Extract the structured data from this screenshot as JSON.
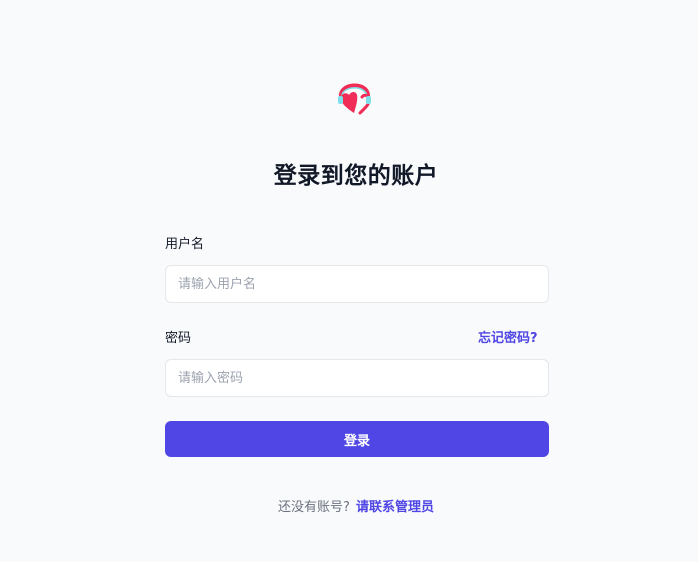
{
  "login": {
    "title": "登录到您的账户",
    "username_label": "用户名",
    "username_placeholder": "请输入用户名",
    "password_label": "密码",
    "forgot_link": "忘记密码?",
    "password_placeholder": "请输入密码",
    "submit_label": "登录",
    "no_account_text": "还没有账号?",
    "contact_admin_link": "请联系管理员"
  },
  "logo": {
    "icon": "heart-headphones-logo-icon"
  },
  "colors": {
    "background": "#f9fafb",
    "accent": "#4f46e5",
    "text": "#111827",
    "muted": "#6b7280",
    "logo_red": "#ef2d56",
    "logo_cyan": "#7ee0ea"
  }
}
